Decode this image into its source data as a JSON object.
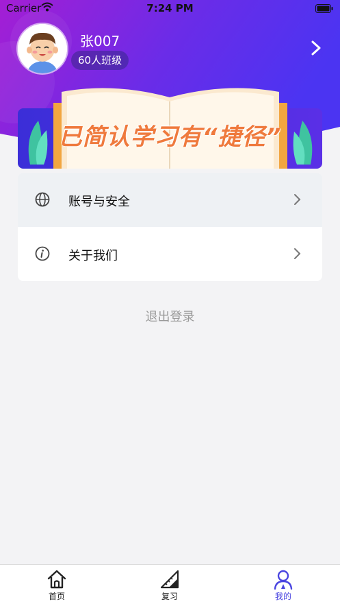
{
  "status_bar": {
    "carrier": "Carrier",
    "time": "7:24 PM"
  },
  "profile": {
    "name": "张007",
    "class_badge": "60人班级"
  },
  "banner": {
    "text": "已简认学习有“捷径”"
  },
  "menu": [
    {
      "label": "账号与安全",
      "icon": "globe-icon"
    },
    {
      "label": "关于我们",
      "icon": "info-icon"
    }
  ],
  "logout_label": "退出登录",
  "tabs": [
    {
      "label": "首页",
      "icon": "home-icon"
    },
    {
      "label": "复习",
      "icon": "ruler-triangle-icon"
    },
    {
      "label": "我的",
      "icon": "person-icon",
      "active": true
    }
  ],
  "colors": {
    "hero_gradient": [
      "#9b1fd6",
      "#5a32f0"
    ],
    "active_tab": "#4a45e0",
    "banner_text": "#ef7a3d"
  }
}
